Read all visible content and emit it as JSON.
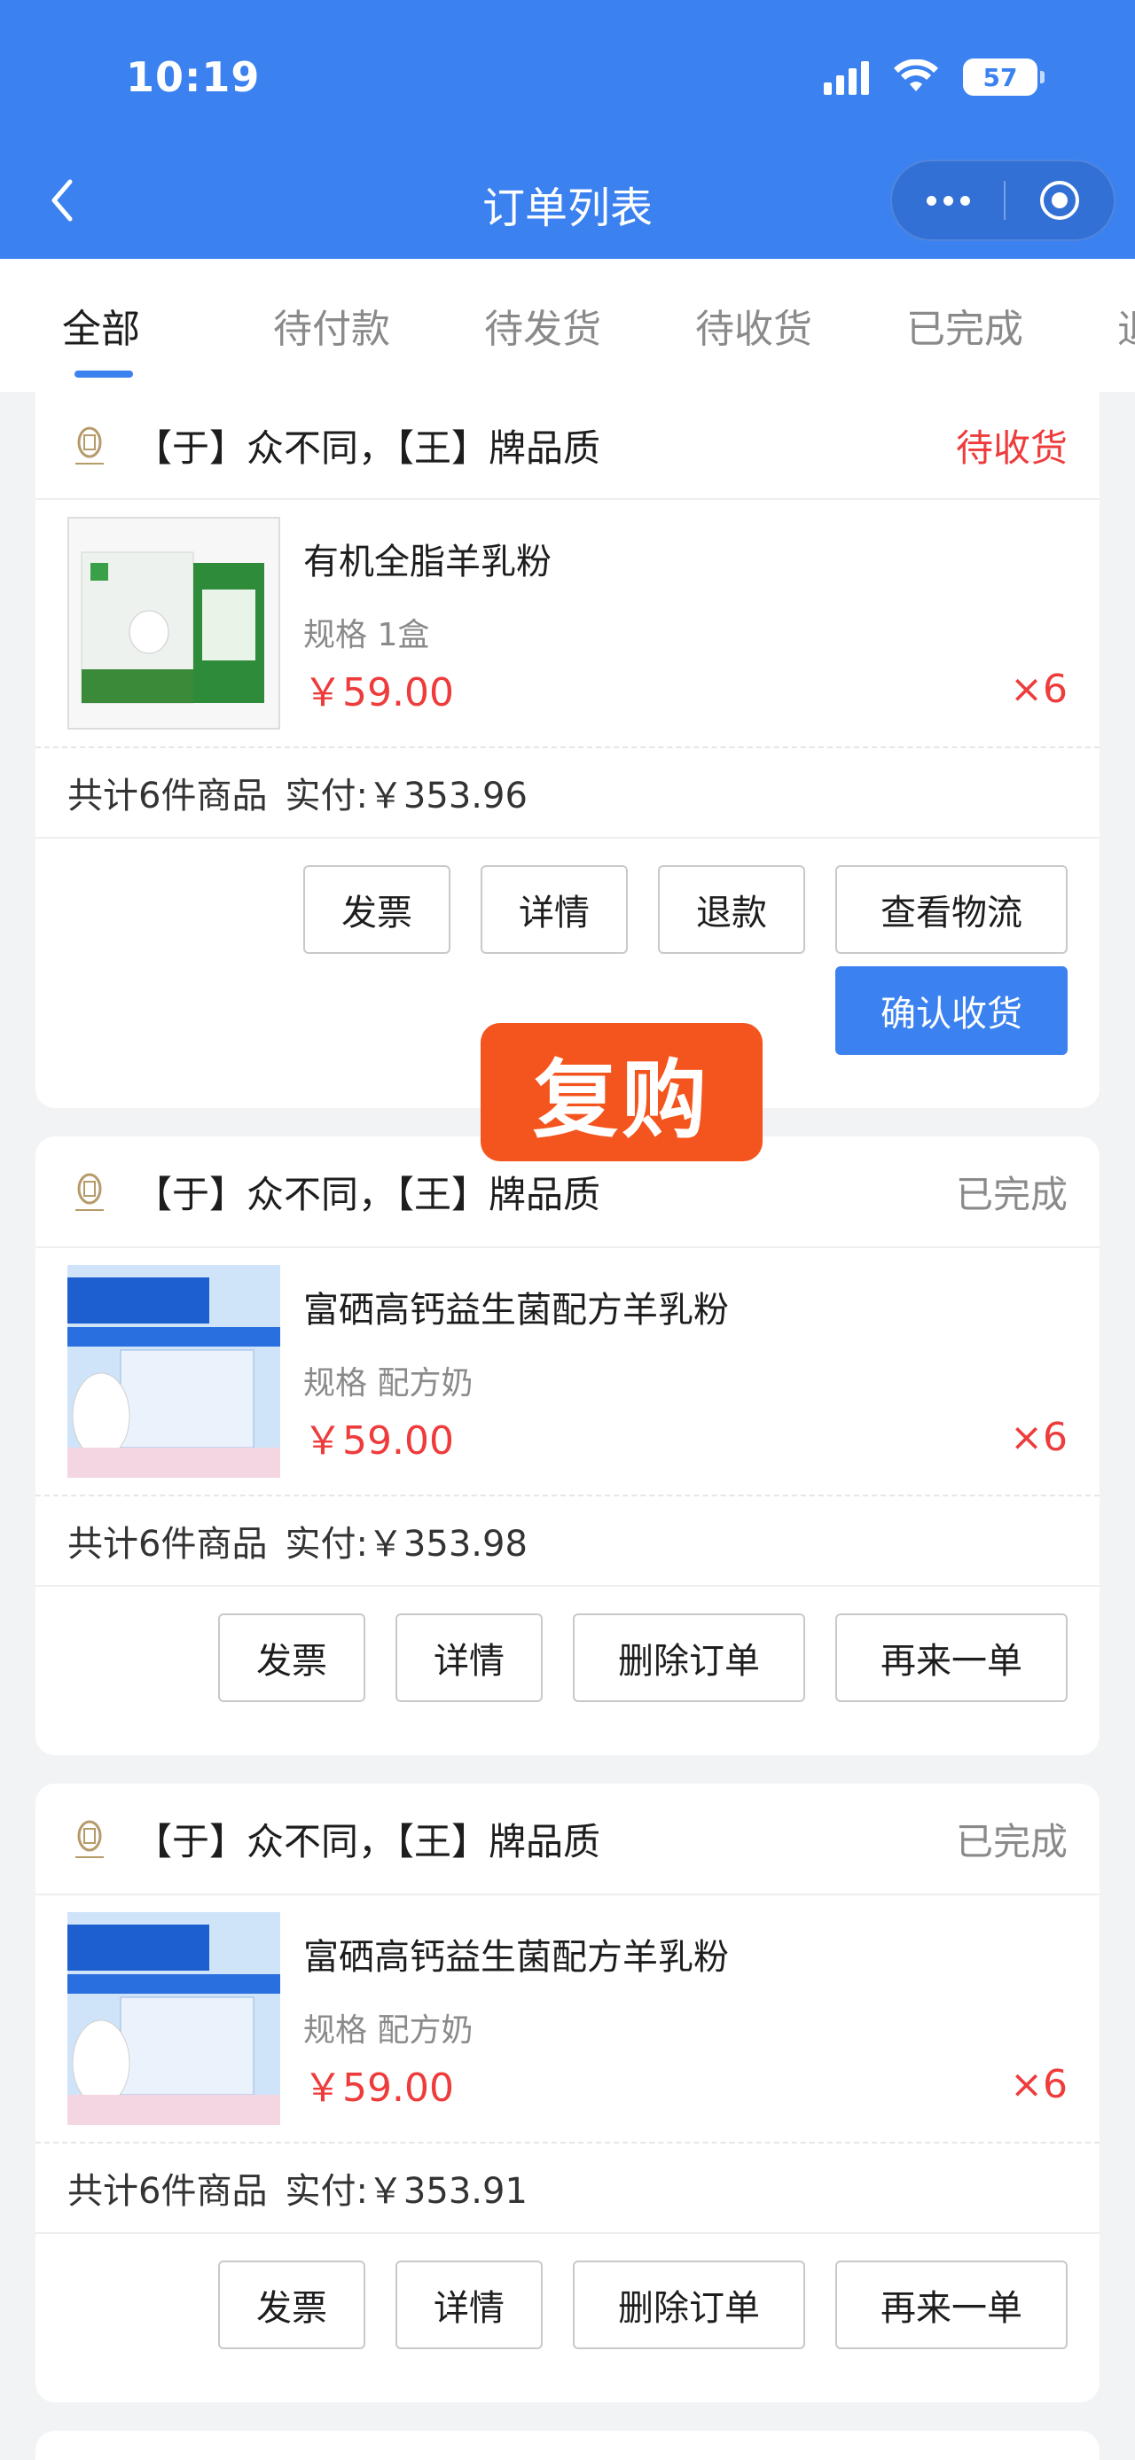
{
  "status_bar": {
    "time": "10:19",
    "battery": "57"
  },
  "header": {
    "title": "订单列表"
  },
  "tabs": [
    {
      "label": "全部",
      "active": true
    },
    {
      "label": "待付款",
      "active": false
    },
    {
      "label": "待发货",
      "active": false
    },
    {
      "label": "待收货",
      "active": false
    },
    {
      "label": "已完成",
      "active": false
    },
    {
      "label": "退款",
      "active": false
    }
  ],
  "overlay_label": "复购",
  "orders": [
    {
      "shop": "【于】众不同，【王】牌品质",
      "status": "待收货",
      "product": {
        "name": "有机全脂羊乳粉",
        "spec": "规格 1盒",
        "price": "￥59.00",
        "qty": "×6"
      },
      "summary": {
        "count": "共计6件商品",
        "paid": "实付:￥353.96"
      },
      "buttons": [
        "发票",
        "详情",
        "退款",
        "查看物流"
      ],
      "primary_button": "确认收货"
    },
    {
      "shop": "【于】众不同，【王】牌品质",
      "status": "已完成",
      "product": {
        "name": "富硒高钙益生菌配方羊乳粉",
        "spec": "规格 配方奶",
        "price": "￥59.00",
        "qty": "×6"
      },
      "summary": {
        "count": "共计6件商品",
        "paid": "实付:￥353.98"
      },
      "buttons": [
        "发票",
        "详情",
        "删除订单",
        "再来一单"
      ]
    },
    {
      "shop": "【于】众不同，【王】牌品质",
      "status": "已完成",
      "product": {
        "name": "富硒高钙益生菌配方羊乳粉",
        "spec": "规格 配方奶",
        "price": "￥59.00",
        "qty": "×6"
      },
      "summary": {
        "count": "共计6件商品",
        "paid": "实付:￥353.91"
      },
      "buttons": [
        "发票",
        "详情",
        "删除订单",
        "再来一单"
      ]
    }
  ],
  "colors": {
    "header_bg": "#3b82f0",
    "accent_red": "#ee3b3b",
    "overlay_orange": "#f4551e"
  }
}
